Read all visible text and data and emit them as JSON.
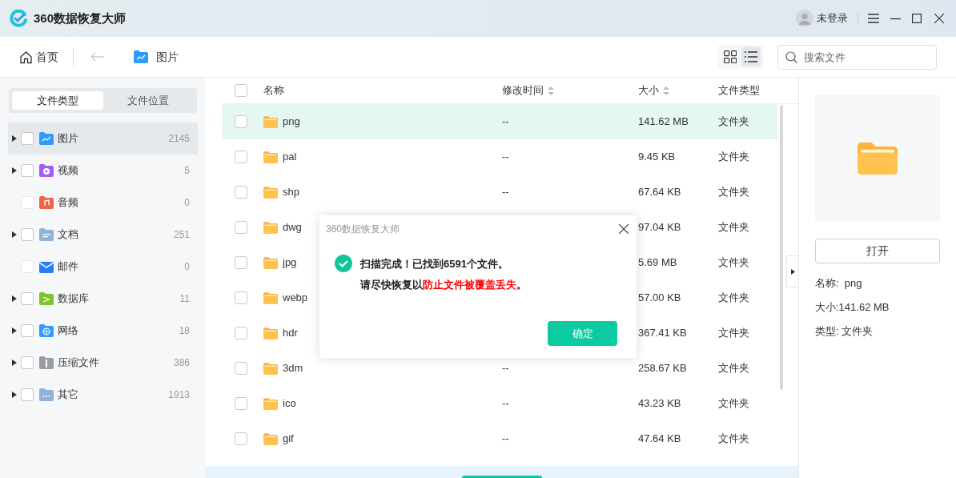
{
  "window": {
    "title": "360数据恢复大师",
    "user": "未登录"
  },
  "toolbar": {
    "home": "首页",
    "location": "图片",
    "view_grid_selected": false,
    "view_list_selected": true,
    "search": {
      "placeholder": "搜索文件"
    }
  },
  "sidebar": {
    "tabs": [
      {
        "label": "文件类型",
        "selected": true
      },
      {
        "label": "文件位置",
        "selected": false
      }
    ],
    "items": [
      {
        "label": "图片",
        "count": "2145",
        "kind": "image",
        "selected": true,
        "disabled": false
      },
      {
        "label": "视频",
        "count": "5",
        "kind": "video",
        "selected": false,
        "disabled": false
      },
      {
        "label": "音频",
        "count": "0",
        "kind": "audio",
        "selected": false,
        "disabled": true
      },
      {
        "label": "文档",
        "count": "251",
        "kind": "doc",
        "selected": false,
        "disabled": false
      },
      {
        "label": "邮件",
        "count": "0",
        "kind": "mail",
        "selected": false,
        "disabled": true
      },
      {
        "label": "数据库",
        "count": "11",
        "kind": "database",
        "selected": false,
        "disabled": false
      },
      {
        "label": "网络",
        "count": "18",
        "kind": "network",
        "selected": false,
        "disabled": false
      },
      {
        "label": "压缩文件",
        "count": "386",
        "kind": "archive",
        "selected": false,
        "disabled": false
      },
      {
        "label": "其它",
        "count": "1913",
        "kind": "other",
        "selected": false,
        "disabled": false
      }
    ]
  },
  "table": {
    "columns": [
      "名称",
      "修改时间",
      "大小",
      "文件类型"
    ],
    "all_checked": false,
    "rows": [
      {
        "name": "png",
        "modified": "--",
        "size": "141.62 MB",
        "type": "文件夹",
        "selected": true
      },
      {
        "name": "pal",
        "modified": "--",
        "size": "9.45 KB",
        "type": "文件夹",
        "selected": false
      },
      {
        "name": "shp",
        "modified": "--",
        "size": "67.64 KB",
        "type": "文件夹",
        "selected": false
      },
      {
        "name": "dwg",
        "size": "97.04 KB",
        "type": "文件夹",
        "selected": false
      },
      {
        "name": "jpg",
        "size": "5.69 MB",
        "type": "文件夹",
        "selected": false
      },
      {
        "name": "webp",
        "size": "57.00 KB",
        "type": "文件夹",
        "selected": false
      },
      {
        "name": "hdr",
        "size": "367.41 KB",
        "type": "文件夹",
        "selected": false
      },
      {
        "name": "3dm",
        "modified": "--",
        "size": "258.67 KB",
        "type": "文件夹",
        "selected": false
      },
      {
        "name": "ico",
        "modified": "--",
        "size": "43.23 KB",
        "type": "文件夹",
        "selected": false
      },
      {
        "name": "gif",
        "modified": "--",
        "size": "47.64 KB",
        "type": "文件夹",
        "selected": false
      }
    ]
  },
  "details": {
    "open_button": "打开",
    "fields": [
      "名称:  png",
      "大小:141.62 MB",
      "类型: 文件夹"
    ]
  },
  "dialog": {
    "title": "360数据恢复大师",
    "message": "扫描完成！已找到6591个文件。",
    "hint": "请尽快恢复以",
    "warning": "防止文件被覆盖丢失",
    "hint_end": "。",
    "ok": "确定"
  }
}
